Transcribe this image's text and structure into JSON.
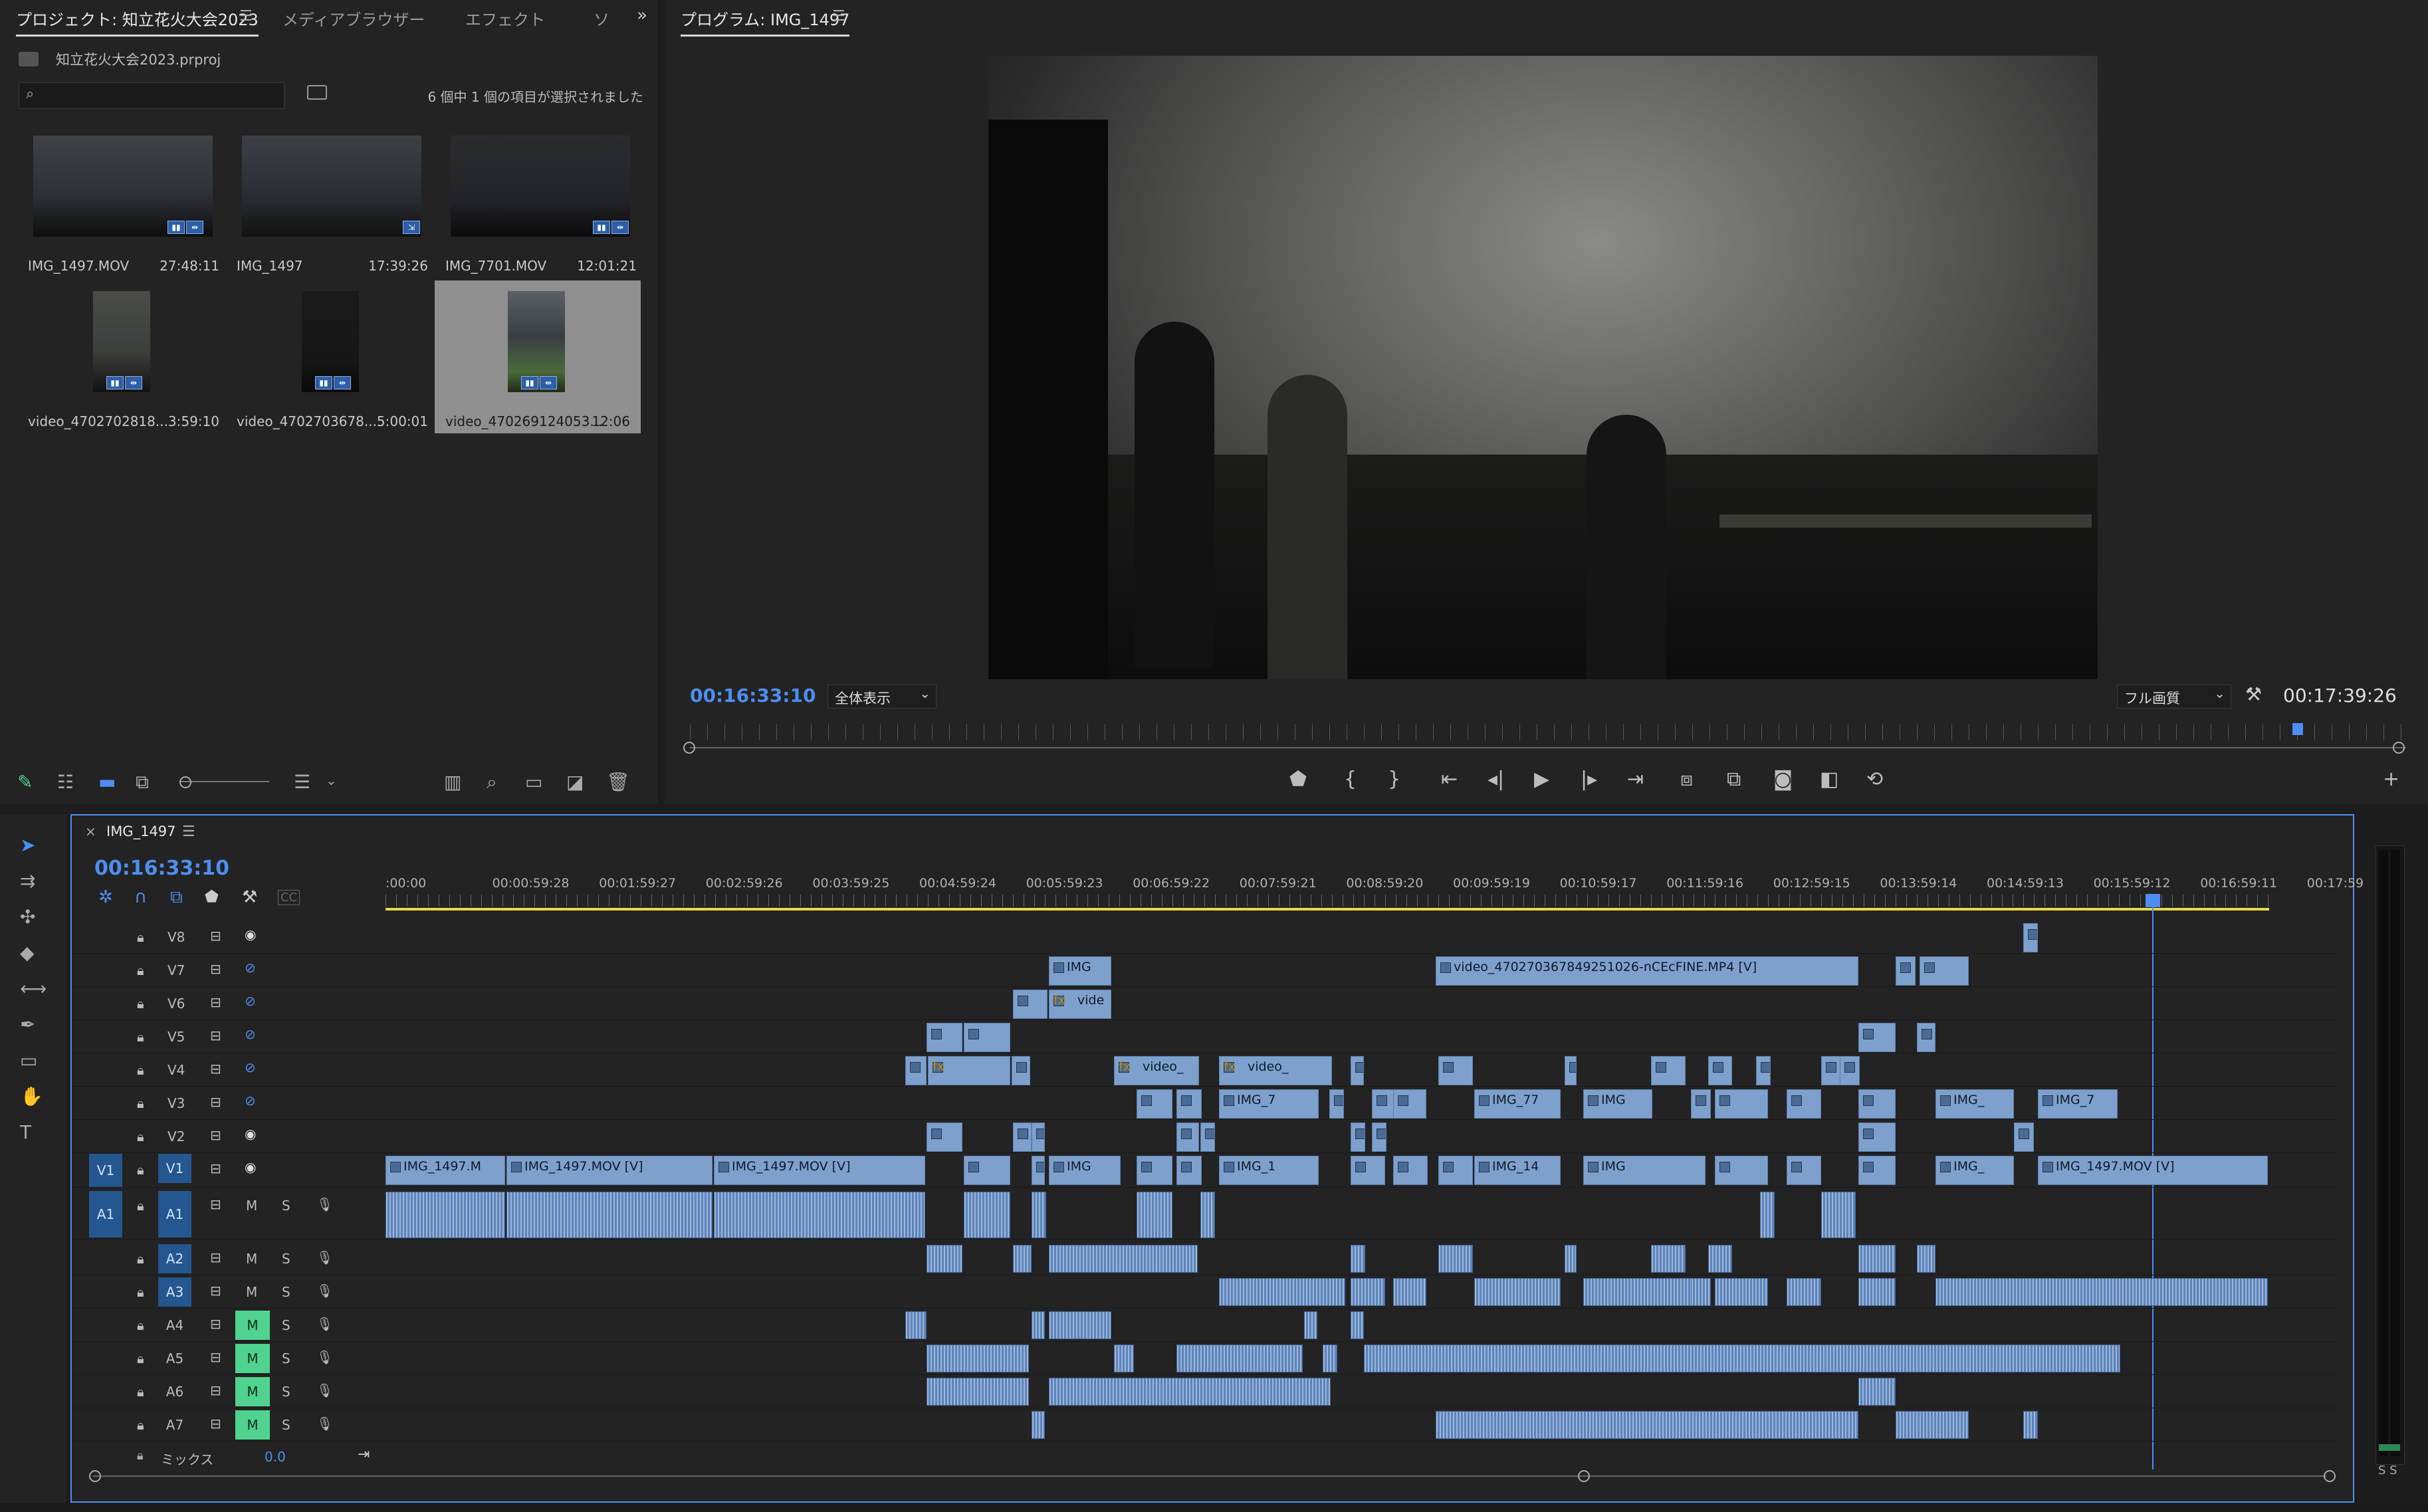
{
  "project": {
    "tabs": [
      "プロジェクト: 知立花火大会2023",
      "メディアブラウザー",
      "エフェクト",
      "ソ"
    ],
    "file_name": "知立花火大会2023.prproj",
    "selection_status": "6 個中 1 個の項目が選択されました",
    "search_placeholder": "",
    "items": [
      {
        "name": "IMG_1497.MOV",
        "duration": "27:48:11"
      },
      {
        "name": "IMG_1497",
        "duration": "17:39:26"
      },
      {
        "name": "IMG_7701.MOV",
        "duration": "12:01:21"
      },
      {
        "name": "video_4702702818...",
        "duration": "3:59:10"
      },
      {
        "name": "video_4702703678...",
        "duration": "5:00:01"
      },
      {
        "name": "video_470269124053...",
        "duration": "12:06"
      }
    ]
  },
  "program": {
    "title": "プログラム: IMG_1497",
    "current_timecode": "00:16:33:10",
    "zoom_label": "全体表示",
    "quality_label": "フル画質",
    "duration_timecode": "00:17:39:26",
    "playhead_fraction": 0.937
  },
  "timeline": {
    "sequence_tab": "IMG_1497",
    "timecode": "00:16:33:10",
    "ruler": [
      ":00:00",
      "00:00:59:28",
      "00:01:59:27",
      "00:02:59:26",
      "00:03:59:25",
      "00:04:59:24",
      "00:05:59:23",
      "00:06:59:22",
      "00:07:59:21",
      "00:08:59:20",
      "00:09:59:19",
      "00:10:59:17",
      "00:11:59:16",
      "00:12:59:15",
      "00:13:59:14",
      "00:14:59:13",
      "00:15:59:12",
      "00:16:59:11",
      "00:17:59"
    ],
    "video_tracks": [
      "V8",
      "V7",
      "V6",
      "V5",
      "V4",
      "V3",
      "V2",
      "V1"
    ],
    "audio_tracks": [
      "A1",
      "A2",
      "A3",
      "A4",
      "A5",
      "A6",
      "A7"
    ],
    "mix_label": "ミックス",
    "mix_value": "0.0",
    "btn_m": "M",
    "btn_s": "S",
    "src_v1": "V1",
    "src_a1": "A1",
    "clip_labels": {
      "v7_a": "IMG",
      "v7_b": "video_470270367849251026-nCEcFINE.MP4 [V]",
      "v6_a": "vide",
      "v4_a": "video_",
      "v4_b": "video_",
      "v3_a": "IMG_7",
      "v3_b": "IMG_77",
      "v3_c": "IMG",
      "v3_d": "IMG_",
      "v3_e": "IMG_7",
      "v1_a": "IMG_1497.M",
      "v1_b": "IMG_1497.MOV [V]",
      "v1_c": "IMG_1497.MOV [V]",
      "v1_d": "IMG",
      "v1_e": "IMG_1",
      "v1_f": "IMG_14",
      "v1_g": "IMG",
      "v1_h": "IMG_",
      "v1_i": "IMG_1497.MOV [V]"
    },
    "fx_label": "fx"
  },
  "meter": {
    "label": "S S"
  },
  "icons": [
    "folder-icon",
    "search-icon",
    "bin-icon",
    "pencil-icon",
    "list-view-icon",
    "icon-view-icon",
    "freeform-view-icon",
    "zoom-slider-icon",
    "sort-icon",
    "automate-icon",
    "find-icon",
    "new-bin-icon",
    "new-item-icon",
    "trash-icon",
    "marker-icon",
    "mark-in-icon",
    "mark-out-icon",
    "go-to-in-icon",
    "step-back-icon",
    "play-icon",
    "step-forward-icon",
    "go-to-out-icon",
    "insert-icon",
    "overwrite-icon",
    "camera-icon",
    "compare-icon",
    "button-editor-icon",
    "selection-tool-icon",
    "track-select-icon",
    "ripple-edit-icon",
    "razor-icon",
    "slip-icon",
    "pen-icon",
    "rectangle-icon",
    "hand-icon",
    "type-icon",
    "lock-icon",
    "eye-icon",
    "mic-icon"
  ]
}
